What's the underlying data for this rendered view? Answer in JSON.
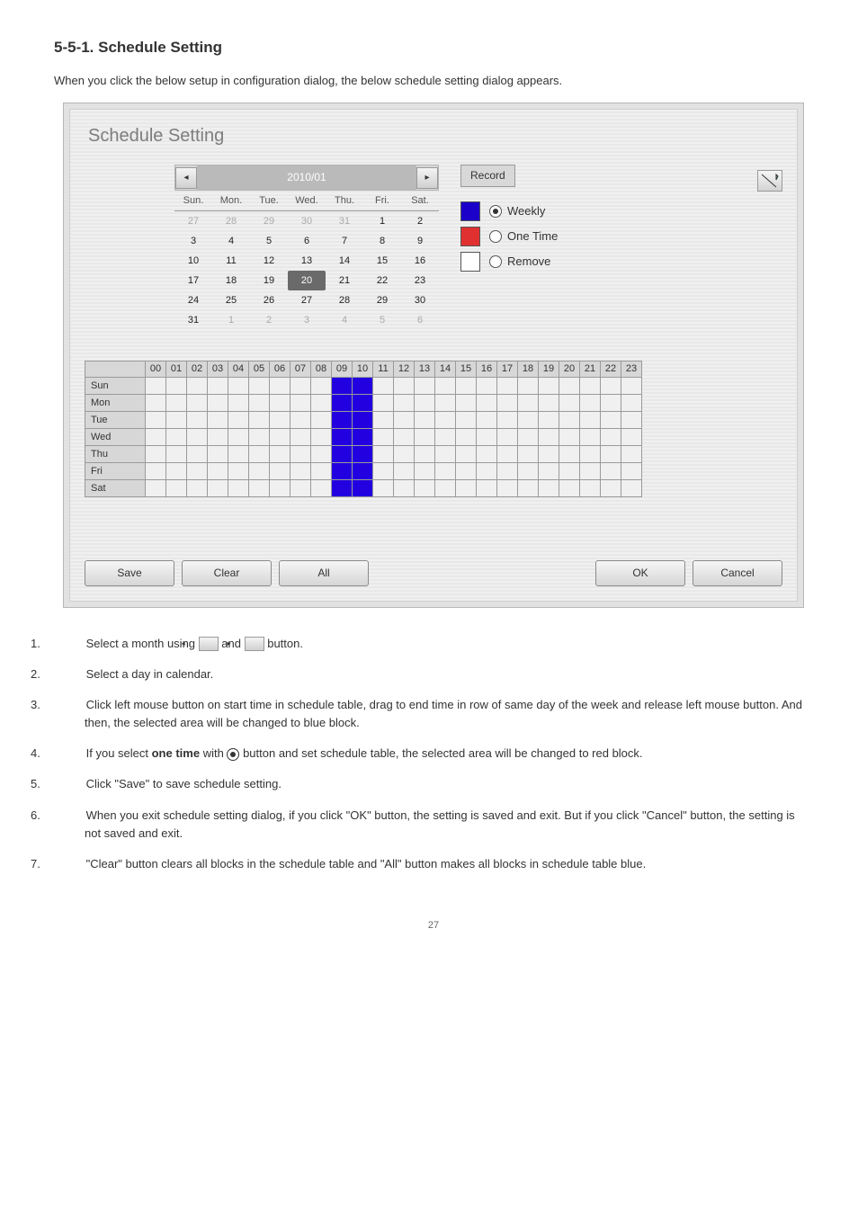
{
  "doc_heading": "5-5-1. Schedule Setting",
  "intro_text": "When you click the below setup in configuration dialog, the below schedule setting dialog appears.",
  "panel": {
    "title": "Schedule Setting",
    "calendar": {
      "month_label": "2010/01",
      "day_headers": [
        "Sun.",
        "Mon.",
        "Tue.",
        "Wed.",
        "Thu.",
        "Fri.",
        "Sat."
      ],
      "rows": [
        [
          {
            "n": "27",
            "dim": true
          },
          {
            "n": "28",
            "dim": true
          },
          {
            "n": "29",
            "dim": true
          },
          {
            "n": "30",
            "dim": true
          },
          {
            "n": "31",
            "dim": true
          },
          {
            "n": "1"
          },
          {
            "n": "2"
          }
        ],
        [
          {
            "n": "3"
          },
          {
            "n": "4"
          },
          {
            "n": "5"
          },
          {
            "n": "6"
          },
          {
            "n": "7"
          },
          {
            "n": "8"
          },
          {
            "n": "9"
          }
        ],
        [
          {
            "n": "10"
          },
          {
            "n": "11"
          },
          {
            "n": "12"
          },
          {
            "n": "13"
          },
          {
            "n": "14"
          },
          {
            "n": "15"
          },
          {
            "n": "16"
          }
        ],
        [
          {
            "n": "17"
          },
          {
            "n": "18"
          },
          {
            "n": "19"
          },
          {
            "n": "20",
            "sel": true
          },
          {
            "n": "21"
          },
          {
            "n": "22"
          },
          {
            "n": "23"
          }
        ],
        [
          {
            "n": "24"
          },
          {
            "n": "25"
          },
          {
            "n": "26"
          },
          {
            "n": "27"
          },
          {
            "n": "28"
          },
          {
            "n": "29"
          },
          {
            "n": "30"
          }
        ],
        [
          {
            "n": "31"
          },
          {
            "n": "1",
            "dim": true
          },
          {
            "n": "2",
            "dim": true
          },
          {
            "n": "3",
            "dim": true
          },
          {
            "n": "4",
            "dim": true
          },
          {
            "n": "5",
            "dim": true
          },
          {
            "n": "6",
            "dim": true
          }
        ]
      ]
    },
    "options": {
      "section_label": "Record",
      "weekly": "Weekly",
      "one_time": "One Time",
      "remove": "Remove"
    },
    "schedule": {
      "hours": [
        "00",
        "01",
        "02",
        "03",
        "04",
        "05",
        "06",
        "07",
        "08",
        "09",
        "10",
        "11",
        "12",
        "13",
        "14",
        "15",
        "16",
        "17",
        "18",
        "19",
        "20",
        "21",
        "22",
        "23"
      ],
      "days": [
        "Sun",
        "Mon",
        "Tue",
        "Wed",
        "Thu",
        "Fri",
        "Sat"
      ],
      "filled": {
        "Sun": [
          9,
          10
        ],
        "Mon": [
          9,
          10
        ],
        "Tue": [
          9,
          10
        ],
        "Wed": [
          9,
          10
        ],
        "Thu": [
          9,
          10
        ],
        "Fri": [
          9,
          10
        ],
        "Sat": [
          9,
          10
        ]
      }
    },
    "buttons": {
      "save": "Save",
      "clear": "Clear",
      "all": "All",
      "ok": "OK",
      "cancel": "Cancel"
    }
  },
  "instructions": {
    "i1_lead": "1.",
    "i1_a": "Select a month using ",
    "i1_b": " and ",
    "i1_c": " button.",
    "i2_lead": "2.",
    "i2": "Select a day in calendar.",
    "i3_lead": "3.",
    "i3": "Click left mouse button on start time in schedule table, drag to end time in row of same day of the week and release left mouse button. And then, the selected area will be changed to blue block.",
    "i4_lead": "4.",
    "i4_a": "If you select ",
    "i4_b_strong": "one time",
    "i4_c": " with ",
    "i4_d": " button and set schedule table, the selected area will be changed to red block.",
    "i5_lead": "5.",
    "i5": "Click \"Save\" to save schedule setting.",
    "i6_lead": "6.",
    "i6": "When you exit schedule setting dialog, if you click \"OK\" button, the setting is saved and exit. But if you click \"Cancel\" button, the setting is not saved and exit.",
    "i7_lead": "7.",
    "i7": "\"Clear\" button clears all blocks in the schedule table and \"All\" button makes all blocks in schedule table blue."
  },
  "page_number": "27"
}
